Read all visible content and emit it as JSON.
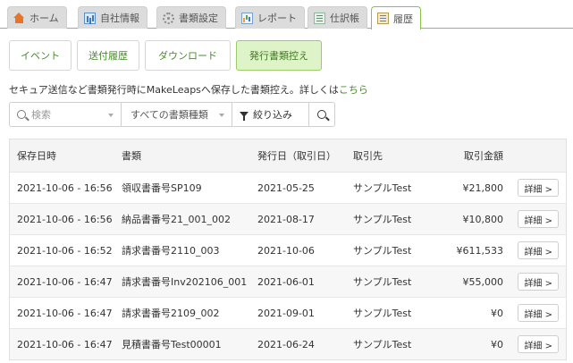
{
  "nav": {
    "tabs": [
      {
        "label": "ホーム",
        "icon": "home-icon"
      },
      {
        "label": "自社情報",
        "icon": "company-icon"
      },
      {
        "label": "書類設定",
        "icon": "gear-icon"
      },
      {
        "label": "レポート",
        "icon": "report-icon"
      },
      {
        "label": "仕訳帳",
        "icon": "journal-icon"
      },
      {
        "label": "履歴",
        "icon": "history-icon",
        "active": true
      }
    ]
  },
  "subtabs": [
    {
      "label": "イベント"
    },
    {
      "label": "送付履歴"
    },
    {
      "label": "ダウンロード"
    },
    {
      "label": "発行書類控え",
      "active": true
    }
  ],
  "description": {
    "text": "セキュア送信など書類発行時にMakeLeapsへ保存した書類控え。詳しくは",
    "link": "こちら"
  },
  "filters": {
    "search_placeholder": "検索",
    "type_select": "すべての書類種類",
    "filter_label": "絞り込み"
  },
  "table": {
    "headers": {
      "saved_at": "保存日時",
      "document": "書類",
      "issue_date": "発行日（取引日）",
      "client": "取引先",
      "amount": "取引金額"
    },
    "detail_label": "詳細 >",
    "rows": [
      {
        "saved_at": "2021-10-06 - 16:56",
        "document": "領収書番号SP109",
        "issue_date": "2021-05-25",
        "client": "サンプルTest",
        "amount": "¥21,800"
      },
      {
        "saved_at": "2021-10-06 - 16:56",
        "document": "納品書番号21_001_002",
        "issue_date": "2021-08-17",
        "client": "サンプルTest",
        "amount": "¥10,800"
      },
      {
        "saved_at": "2021-10-06 - 16:52",
        "document": "請求書番号2110_003",
        "issue_date": "2021-10-06",
        "client": "サンプルTest",
        "amount": "¥611,533"
      },
      {
        "saved_at": "2021-10-06 - 16:47",
        "document": "請求書番号Inv202106_001",
        "issue_date": "2021-06-01",
        "client": "サンプルTest",
        "amount": "¥55,000"
      },
      {
        "saved_at": "2021-10-06 - 16:47",
        "document": "請求書番号2109_002",
        "issue_date": "2021-09-01",
        "client": "サンプルTest",
        "amount": "¥0"
      },
      {
        "saved_at": "2021-10-06 - 16:47",
        "document": "見積書番号Test00001",
        "issue_date": "2021-06-24",
        "client": "サンプルTest",
        "amount": "¥0"
      }
    ]
  },
  "colors": {
    "accent_green": "#4a8b2c",
    "active_tab_bg": "#dff3c8",
    "tab_inactive_bg": "#dcdcdc"
  }
}
